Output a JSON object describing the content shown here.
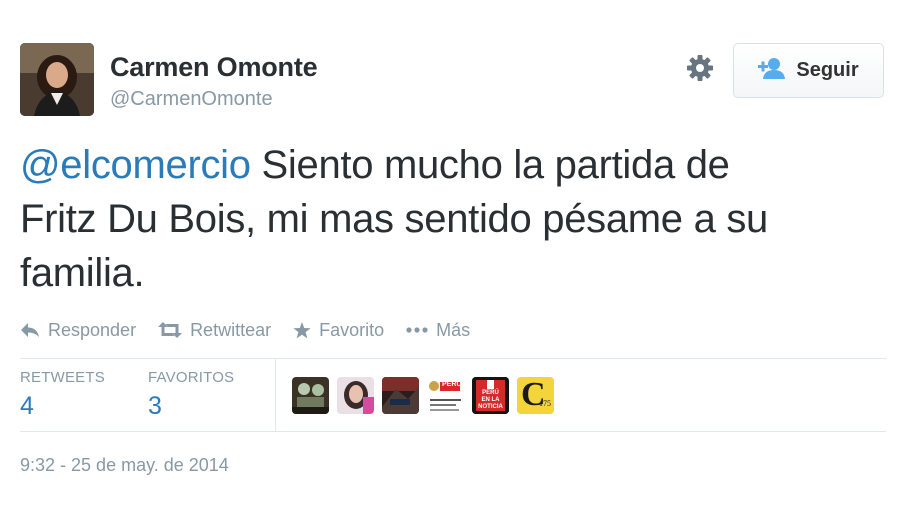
{
  "user": {
    "fullname": "Carmen Omonte",
    "username": "@CarmenOmonte"
  },
  "follow_button": {
    "label": "Seguir",
    "icon": "add-user-icon"
  },
  "settings": {
    "icon": "gear-icon"
  },
  "tweet": {
    "mention": "@elcomercio",
    "text_line1": " Siento mucho la partida de",
    "text_line2": "Fritz Du Bois, mi mas sentido pésame a su",
    "text_line3": "familia."
  },
  "actions": [
    {
      "label": "Responder",
      "icon": "reply-icon"
    },
    {
      "label": "Retwittear",
      "icon": "retweet-icon"
    },
    {
      "label": "Favorito",
      "icon": "star-icon"
    },
    {
      "label": "Más",
      "icon": "more-dots-icon"
    }
  ],
  "stats": {
    "retweets_label": "RETWEETS",
    "retweets_value": "4",
    "favorites_label": "FAVORITOS",
    "favorites_value": "3"
  },
  "favoriters": [
    {
      "icon": "favoriter-avatar-1"
    },
    {
      "icon": "favoriter-avatar-2"
    },
    {
      "icon": "favoriter-avatar-3"
    },
    {
      "icon": "peru-gov-logo",
      "text": "PERÚ"
    },
    {
      "icon": "peru-en-la-noticia-logo",
      "text_lines": [
        "PERÚ",
        "EN LA",
        "NOTICIA"
      ]
    },
    {
      "icon": "el-comercio-logo",
      "text": "C",
      "number": "175"
    }
  ],
  "timestamp": "9:32 - 25 de may. de 2014",
  "colors": {
    "link": "#2b7bb9",
    "muted": "#8899a6",
    "text": "#292f33"
  }
}
